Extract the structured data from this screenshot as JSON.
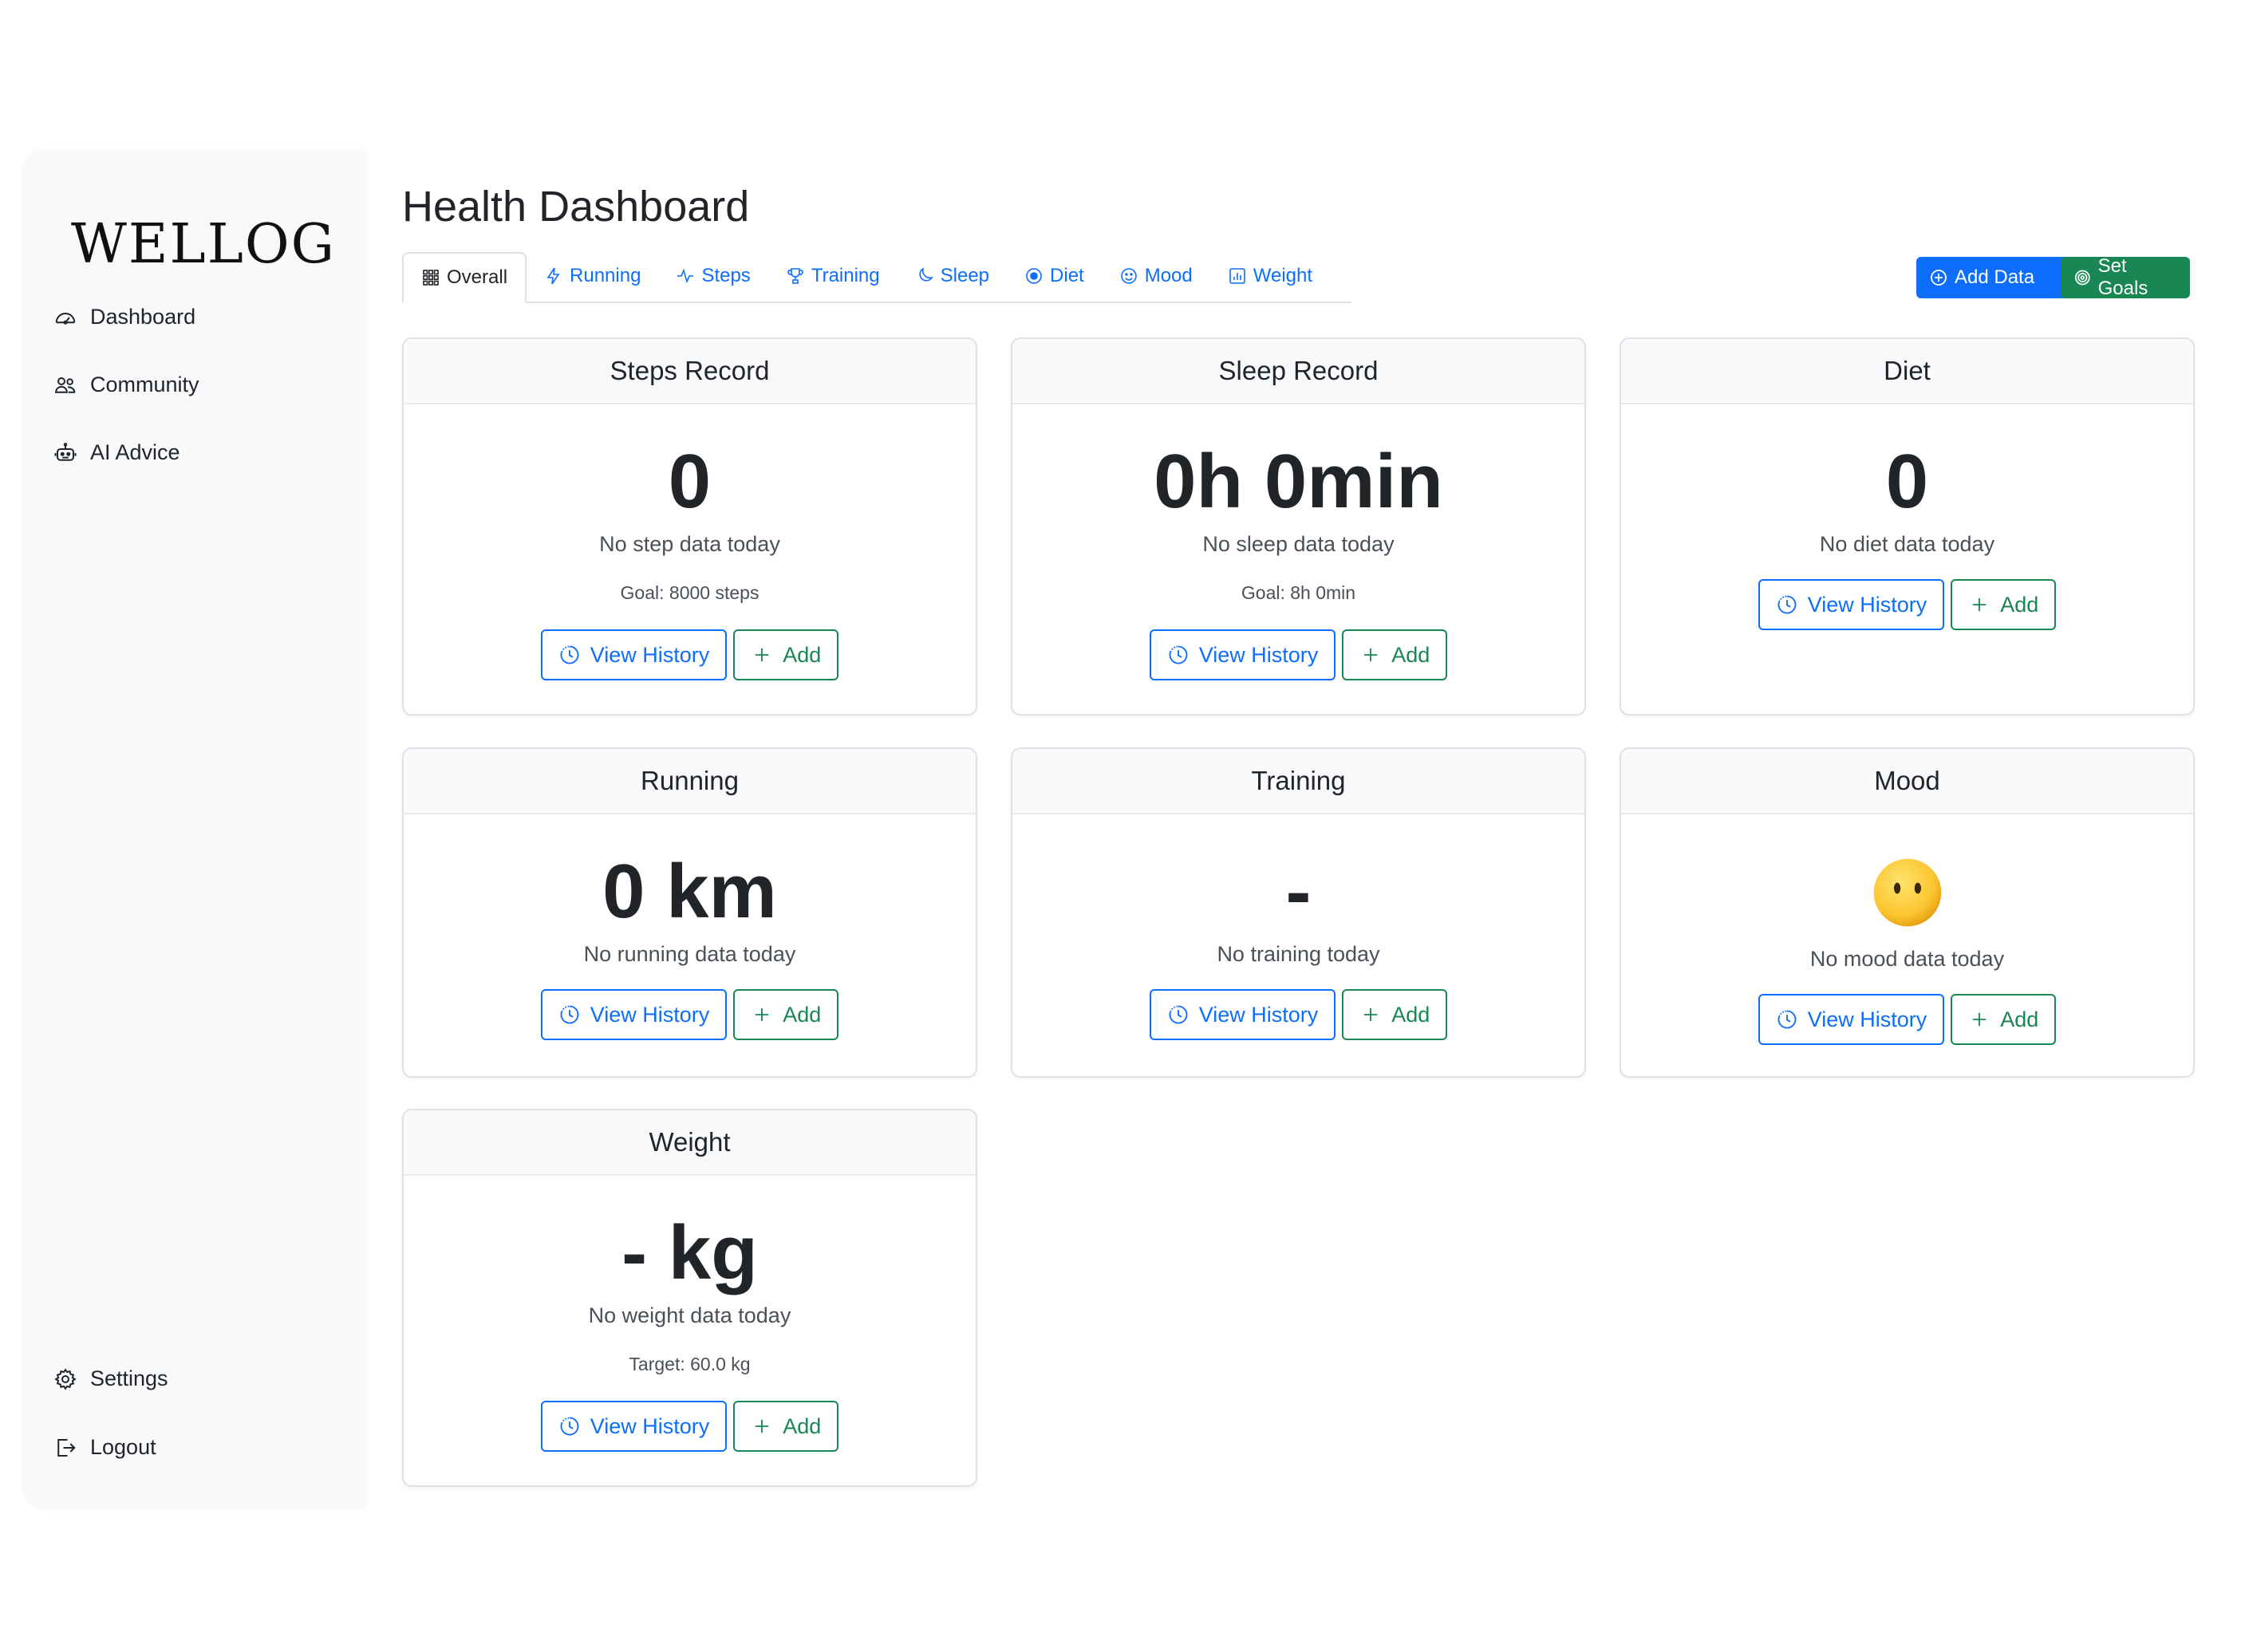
{
  "app": {
    "logo": "WELLOG"
  },
  "sidebar": {
    "items": [
      {
        "label": "Dashboard",
        "icon": "speedometer-icon"
      },
      {
        "label": "Community",
        "icon": "people-icon"
      },
      {
        "label": "AI Advice",
        "icon": "robot-icon"
      }
    ],
    "bottom_items": [
      {
        "label": "Settings",
        "icon": "gear-icon"
      },
      {
        "label": "Logout",
        "icon": "logout-icon"
      }
    ]
  },
  "header": {
    "title": "Health Dashboard",
    "add_data_label": "Add Data",
    "set_goals_label": "Set Goals"
  },
  "tabs": [
    {
      "label": "Overall",
      "icon": "grid-icon",
      "active": true
    },
    {
      "label": "Running",
      "icon": "lightning-icon"
    },
    {
      "label": "Steps",
      "icon": "activity-icon"
    },
    {
      "label": "Training",
      "icon": "trophy-icon"
    },
    {
      "label": "Sleep",
      "icon": "moon-icon"
    },
    {
      "label": "Diet",
      "icon": "record-circle-icon"
    },
    {
      "label": "Mood",
      "icon": "emoji-smile-icon"
    },
    {
      "label": "Weight",
      "icon": "bar-chart-icon"
    }
  ],
  "cards": {
    "steps": {
      "title": "Steps Record",
      "value": "0",
      "status": "No step data today",
      "goal": "Goal: 8000 steps"
    },
    "sleep": {
      "title": "Sleep Record",
      "value": "0h 0min",
      "status": "No sleep data today",
      "goal": "Goal: 8h 0min"
    },
    "diet": {
      "title": "Diet",
      "value": "0",
      "status": "No diet data today"
    },
    "running": {
      "title": "Running",
      "value": "0 km",
      "status": "No running data today"
    },
    "training": {
      "title": "Training",
      "value": "-",
      "status": "No training today"
    },
    "mood": {
      "title": "Mood",
      "icon": "neutral-face-icon",
      "status": "No mood data today"
    },
    "weight": {
      "title": "Weight",
      "value": "- kg",
      "status": "No weight data today",
      "goal": "Target: 60.0 kg"
    }
  },
  "buttons": {
    "view_history": "View History",
    "add": "Add"
  },
  "colors": {
    "primary": "#0d6efd",
    "success": "#198754",
    "sidebar_bg": "#f8f9fa",
    "text": "#212529"
  }
}
